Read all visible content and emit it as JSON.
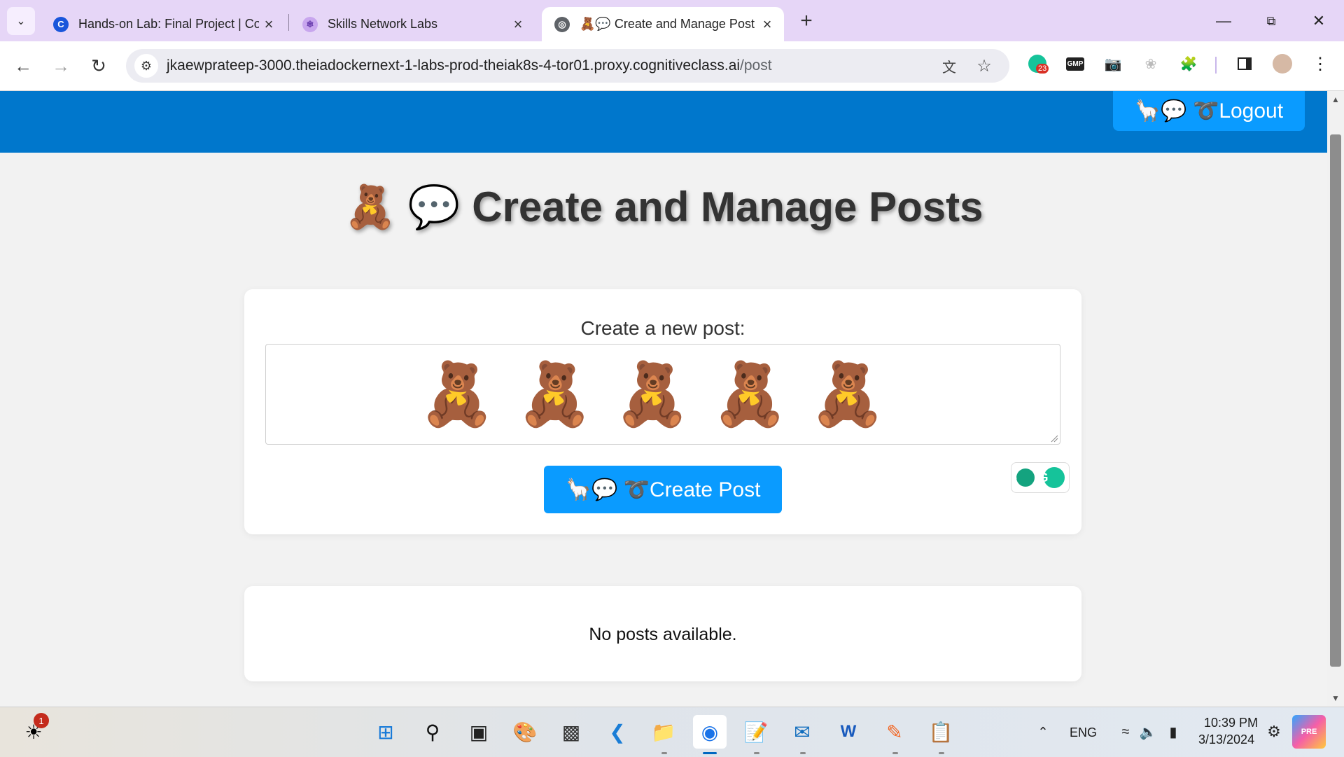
{
  "browser": {
    "tabs": [
      {
        "title": "Hands-on Lab: Final Project | Co",
        "favicon": "coursera-icon",
        "active": false
      },
      {
        "title": "Skills Network Labs",
        "favicon": "skills-network-icon",
        "active": false
      },
      {
        "title": "🧸💬 Create and Manage Post",
        "favicon": "globe-icon",
        "active": true
      }
    ],
    "url_host": "jkaewprateep-3000.theiadockernext-1-labs-prod-theiak8s-4-tor01.proxy.cognitiveclass.ai",
    "url_path": "/post",
    "extension_badge": "23",
    "extension_gmp": "GMP"
  },
  "app": {
    "logout_label": "🦙💬 ➰Logout",
    "page_title": "🧸 💬 Create and Manage Posts",
    "create_label": "Create a new post:",
    "textarea_value": "🧸🧸🧸🧸🧸",
    "create_button_label": "🦙💬 ➰Create Post",
    "empty_message": "No posts available."
  },
  "taskbar": {
    "notification_count": "1",
    "language": "ENG",
    "time": "10:39 PM",
    "date": "3/13/2024",
    "copilot_badge": "PRE"
  },
  "colors": {
    "header_blue": "#0077cc",
    "button_blue": "#0a9bff",
    "tabstrip": "#e6d6f7"
  }
}
